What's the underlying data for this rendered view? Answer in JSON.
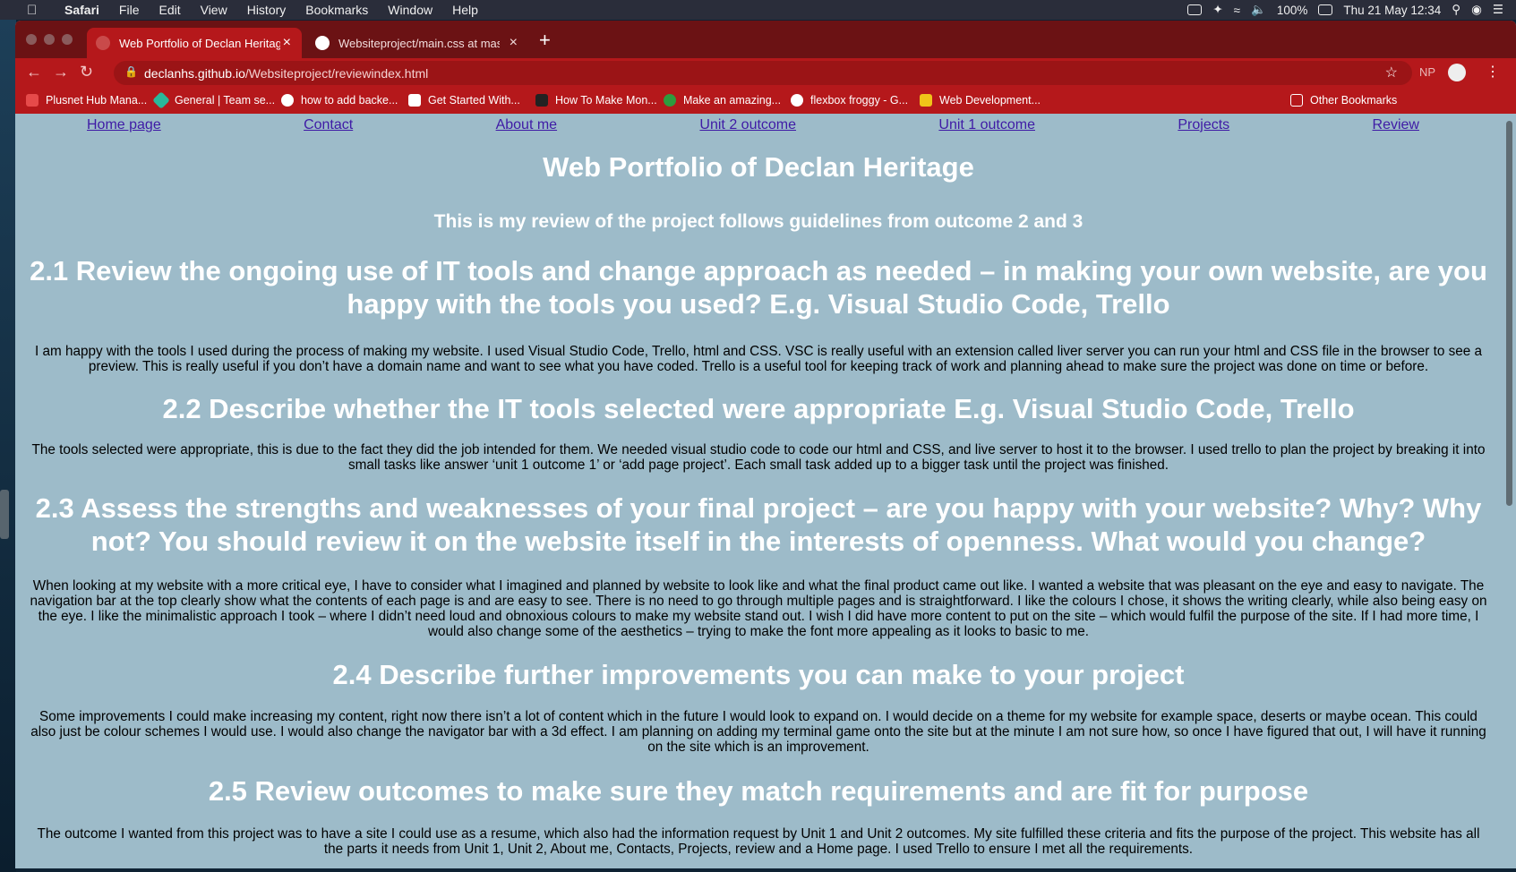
{
  "menubar": {
    "app": "Safari",
    "items": [
      "File",
      "Edit",
      "View",
      "History",
      "Bookmarks",
      "Window",
      "Help"
    ],
    "battery": "100%",
    "datetime": "Thu 21 May  12:34"
  },
  "browser": {
    "tabs": [
      {
        "title": "Web Portfolio of Declan Heritage",
        "close": "×"
      },
      {
        "title": "Websiteproject/main.css at master",
        "close": "×"
      }
    ],
    "new_tab": "+",
    "url_domain": "declanhs.github.io",
    "url_path": "/Websiteproject/reviewindex.html",
    "ext_label": "NP",
    "bookmarks": [
      "Plusnet Hub Mana...",
      "General | Team se...",
      "how to add backe...",
      "Get Started With...",
      "How To Make Mon...",
      "Make an amazing...",
      "flexbox froggy - G...",
      "Web Development...",
      "Other Bookmarks"
    ],
    "colors": {
      "tab_bar": "#6b1214",
      "toolbar": "#b5181b",
      "page_bg": "#9dbbc9",
      "link": "#3f1ba6"
    }
  },
  "page": {
    "nav": [
      "Home page",
      "Contact",
      "About me",
      "Unit 2 outcome",
      "Unit 1 outcome",
      "Projects",
      "Review"
    ],
    "title": "Web Portfolio of Declan Heritage",
    "subtitle": "This is my review of the project follows guidelines from outcome 2 and 3",
    "sections": [
      {
        "heading": "2.1 Review the ongoing use of IT tools and change approach as needed – in making your own website, are you happy with the tools you used? E.g. Visual Studio Code, Trello",
        "body": "I am happy with the tools I used during the process of making my website. I used Visual Studio Code, Trello, html and CSS. VSC is really useful with an extension called liver server you can run your html and CSS file in the browser to see a preview. This is really useful if you don’t have a domain name and want to see what you have coded. Trello is a useful tool for keeping track of work and planning ahead to make sure the project was done on time or before."
      },
      {
        "heading": "2.2 Describe whether the IT tools selected were appropriate E.g. Visual Studio Code, Trello",
        "body": "The tools selected were appropriate, this is due to the fact they did the job intended for them. We needed visual studio code to code our html and CSS, and live server to host it to the browser. I used trello to plan the project by breaking it into small tasks like answer ‘unit 1 outcome 1’ or ‘add page project’. Each small task added up to a bigger task until the project was finished."
      },
      {
        "heading": "2.3 Assess the strengths and weaknesses of your final project – are you happy with your website? Why? Why not? You should review it on the website itself in the interests of openness. What would you change?",
        "body": "When looking at my website with a more critical eye, I have to consider what I imagined and planned by website to look like and what the final product came out like. I wanted a website that was pleasant on the eye and easy to navigate. The navigation bar at the top clearly show what the contents of each page is and are easy to see. There is no need to go through multiple pages and is straightforward. I like the colours I chose, it shows the writing clearly, while also being easy on the eye. I like the minimalistic approach I took – where I didn’t need loud and obnoxious colours to make my website stand out. I wish I did have more content to put on the site – which would fulfil the purpose of the site. If I had more time, I would also change some of the aesthetics – trying to make the font more appealing as it looks to basic to me."
      },
      {
        "heading": "2.4 Describe further improvements you can make to your project",
        "body": "Some improvements I could make increasing my content, right now there isn’t a lot of content which in the future I would look to expand on. I would decide on a theme for my website for example space, deserts or maybe ocean. This could also just be colour schemes I would use. I would also change the navigator bar with a 3d effect. I am planning on adding my terminal game onto the site but at the minute I am not sure how, so once I have figured that out, I will have it running on the site which is an improvement."
      },
      {
        "heading": "2.5 Review outcomes to make sure they match requirements and are fit for purpose",
        "body": "The outcome I wanted from this project was to have a site I could use as a resume, which also had the information request by Unit 1 and Unit 2 outcomes. My site fulfilled these criteria and fits the purpose of the project. This website has all the parts it needs from Unit 1, Unit 2, About me, Contacts, Projects, review and a Home page. I used Trello to ensure I met all the requirements."
      }
    ]
  }
}
